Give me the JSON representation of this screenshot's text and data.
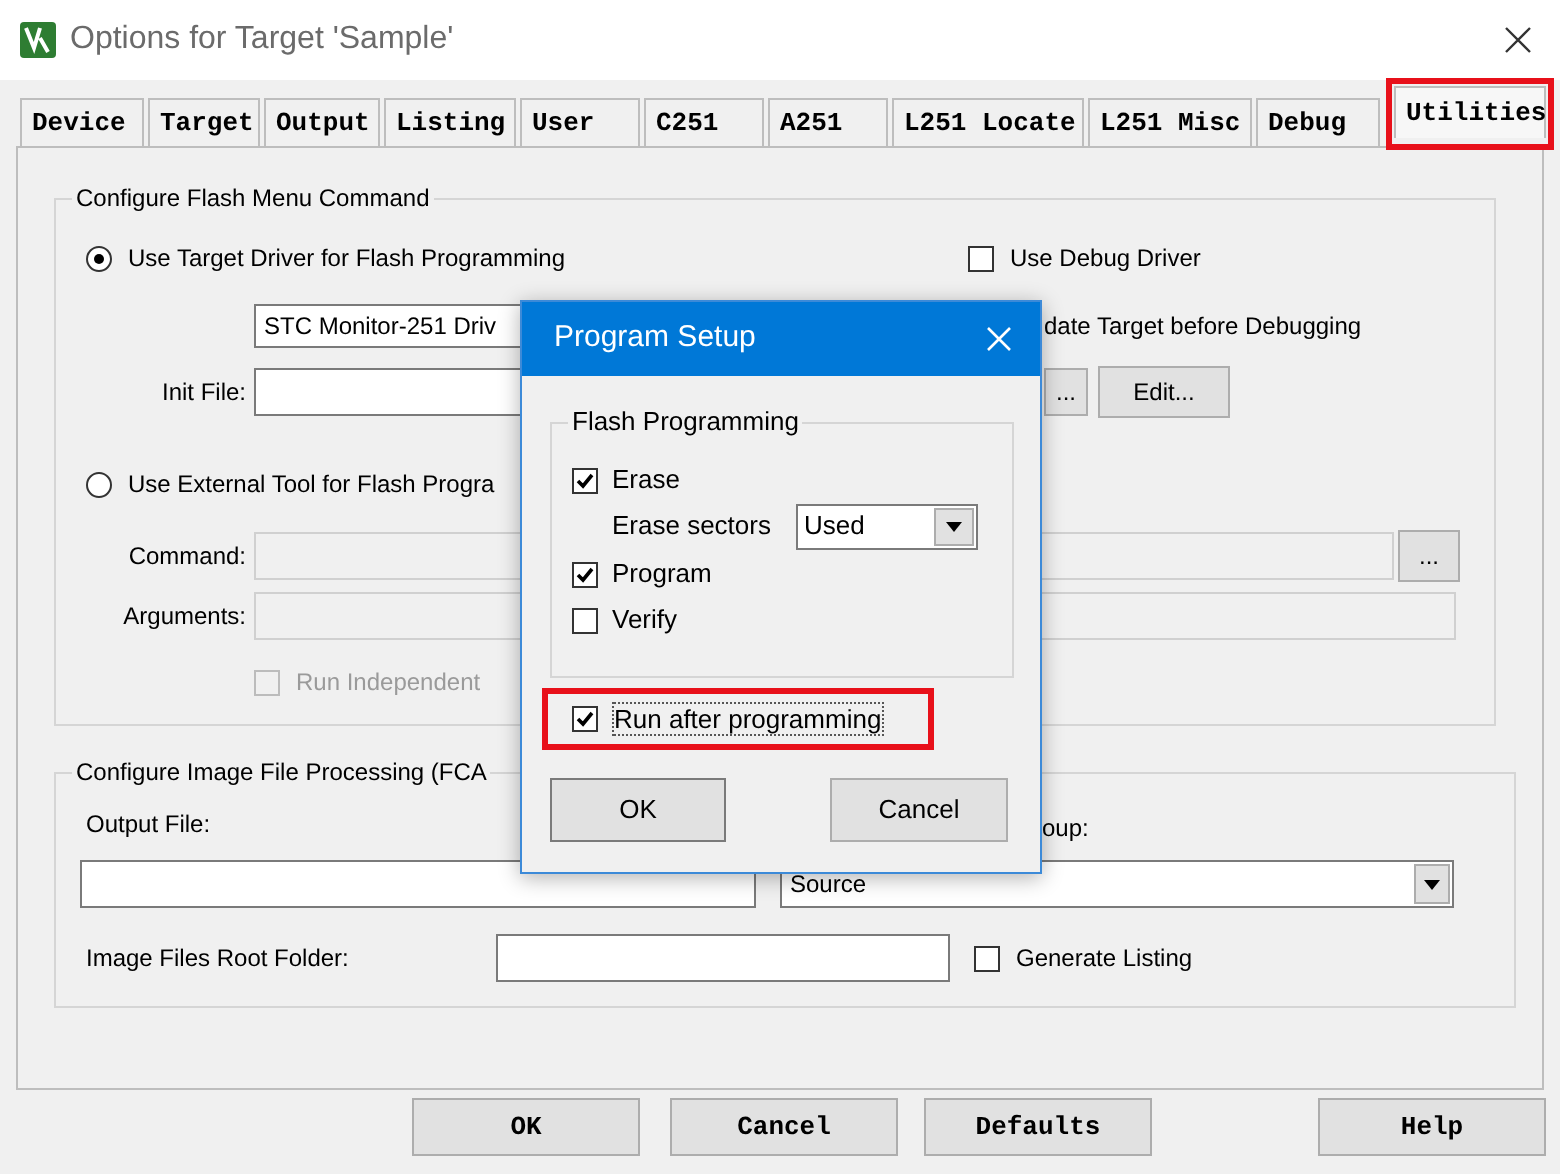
{
  "window": {
    "title": "Options for Target 'Sample'"
  },
  "tabs": [
    {
      "label": "Device",
      "selected": false,
      "highlighted": false
    },
    {
      "label": "Target",
      "selected": false,
      "highlighted": false
    },
    {
      "label": "Output",
      "selected": false,
      "highlighted": false
    },
    {
      "label": "Listing",
      "selected": false,
      "highlighted": false
    },
    {
      "label": "User",
      "selected": false,
      "highlighted": false
    },
    {
      "label": "C251",
      "selected": false,
      "highlighted": false
    },
    {
      "label": "A251",
      "selected": false,
      "highlighted": false
    },
    {
      "label": "L251 Locate",
      "selected": false,
      "highlighted": false
    },
    {
      "label": "L251 Misc",
      "selected": false,
      "highlighted": false
    },
    {
      "label": "Debug",
      "selected": false,
      "highlighted": false
    },
    {
      "label": "Utilities",
      "selected": true,
      "highlighted": true
    }
  ],
  "flash_menu": {
    "title": "Configure Flash Menu Command",
    "radios": [
      {
        "label": "Use Target Driver for Flash Programming",
        "selected": true
      },
      {
        "label": "Use External Tool for Flash Progra",
        "selected": false
      }
    ],
    "driver": "STC Monitor-251 Driv",
    "init_file_label": "Init File:",
    "use_debug_driver": {
      "label": "Use Debug Driver",
      "checked": false
    },
    "update_target_label": "date Target before Debugging",
    "browse_button": "...",
    "edit_button": "Edit...",
    "command_label": "Command:",
    "command_browse": "...",
    "arguments_label": "Arguments:",
    "run_independent": {
      "label": "Run Independent",
      "checked": false,
      "disabled": true
    }
  },
  "image_processing": {
    "title": "Configure Image File Processing (FCA",
    "output_file_label": "Output File:",
    "group_label": "oup:",
    "group_value": "Source",
    "root_folder_label": "Image Files Root Folder:",
    "generate_listing": {
      "label": "Generate Listing",
      "checked": false
    }
  },
  "buttons": [
    "OK",
    "Cancel",
    "Defaults",
    "Help"
  ],
  "program_setup": {
    "title": "Program Setup",
    "group_title": "Flash Programming",
    "erase": {
      "label": "Erase",
      "checked": true
    },
    "erase_sectors_label": "Erase sectors",
    "erase_sectors_value": "Used",
    "program": {
      "label": "Program",
      "checked": true
    },
    "verify": {
      "label": "Verify",
      "checked": false
    },
    "run_after": {
      "label": "Run after programming",
      "checked": true,
      "highlighted": true
    },
    "ok": "OK",
    "cancel": "Cancel"
  }
}
